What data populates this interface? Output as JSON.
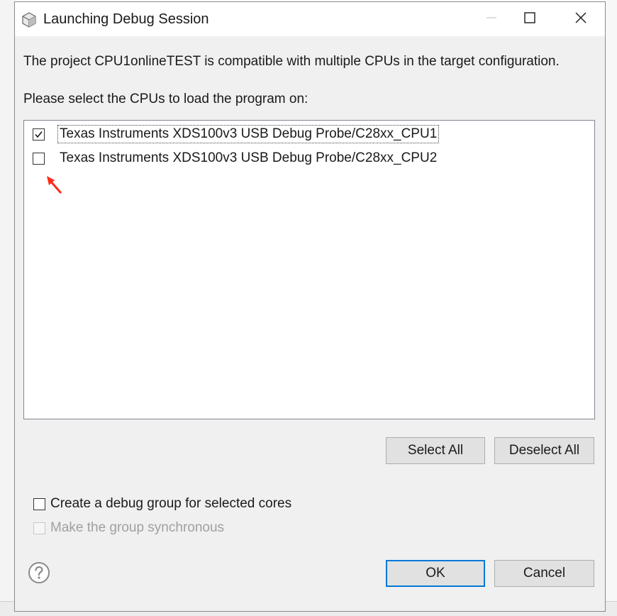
{
  "window": {
    "title": "Launching Debug Session"
  },
  "message": {
    "compatibility": "The project CPU1onlineTEST is compatible with multiple CPUs in the target configuration.",
    "prompt": "Please select the CPUs to load the program on:"
  },
  "cpus": [
    {
      "label": "Texas Instruments XDS100v3 USB Debug Probe/C28xx_CPU1",
      "checked": true
    },
    {
      "label": "Texas Instruments XDS100v3 USB Debug Probe/C28xx_CPU2",
      "checked": false
    }
  ],
  "buttons": {
    "select_all": "Select All",
    "deselect_all": "Deselect All",
    "ok": "OK",
    "cancel": "Cancel"
  },
  "options": {
    "debug_group_label": "Create a debug group for selected cores",
    "debug_group_checked": false,
    "synchronous_label": "Make the group synchronous",
    "synchronous_enabled": false,
    "synchronous_checked": false
  },
  "icons": {
    "title": "debug-session-icon",
    "minimize": "minimize-icon",
    "maximize": "maximize-icon",
    "close": "close-icon",
    "help": "help-icon",
    "annotation": "red-arrow-icon"
  },
  "colors": {
    "dialog_bg": "#f0f0f0",
    "default_button_border": "#0078d7",
    "annotation_arrow": "#ff2a1a"
  }
}
